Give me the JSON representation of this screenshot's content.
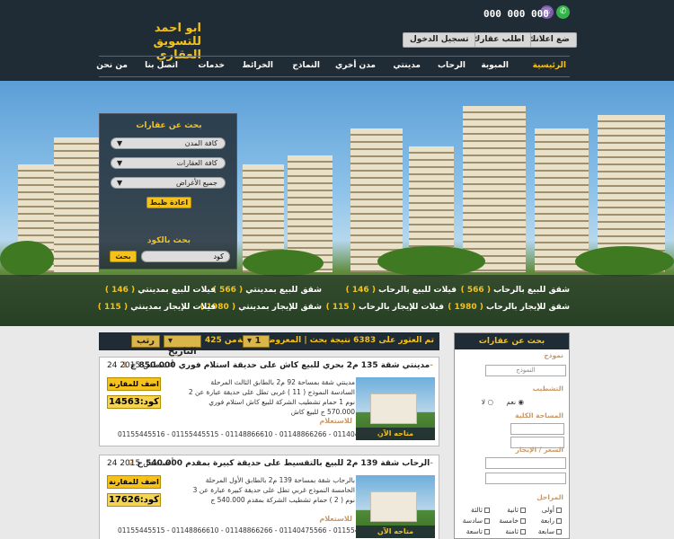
{
  "header": {
    "phone": "000 000 000",
    "brand_line1": "ابو احمد",
    "brand_line2": "للتسويق العقاري",
    "buttons": [
      "ضع اعلانك",
      "اطلب عقارك",
      "تسجيل الدخول"
    ]
  },
  "nav": [
    "الرئيسية",
    "المبوبة",
    "الرحاب",
    "مدينتي",
    "مدن أخري",
    "النماذج",
    "الخرائط",
    "خدمات",
    "اتصل بنا",
    "من نحن"
  ],
  "hero_search": {
    "title": "بحث عن عقارات",
    "select_city": "كافة المدن",
    "select_type": "كافة العقارات",
    "select_purpose": "جميع الأغراض",
    "reset_label": "اعادة ظبط",
    "code_title": "بحث بالكود",
    "code_placeholder": "كود",
    "search_label": "بحث"
  },
  "categories": [
    {
      "label": "شقق للبيع بالرحاب",
      "count": "( 566 )"
    },
    {
      "label": "فيلات للبيع بالرحاب",
      "count": "( 146 )"
    },
    {
      "label": "شقق للبيع بمدينتي",
      "count": "( 566 )"
    },
    {
      "label": "فيلات للبيع بمدينتي",
      "count": "( 146 )"
    },
    {
      "label": "شقق للإيجار بالرحاب",
      "count": "( 1980 )"
    },
    {
      "label": "فيلات للإيجار بالرحاب",
      "count": "( 115 )"
    },
    {
      "label": "شقق للإيجار بمدينتي",
      "count": "( 1980 )"
    },
    {
      "label": "فيلات للإيجار بمدينتي",
      "count": "( 115 )"
    }
  ],
  "results": {
    "summary": "تم العثور على 6383 نتيجة بحث | المعروض صفحة",
    "page": "1",
    "of_pages": "من 425",
    "sort_field": "التاريخ",
    "sort_label": "رتب"
  },
  "listings": [
    {
      "index": "1-",
      "title": "مدينتي شقة 135 م2 بحري للبيع كاش على حديقة استلام فوري 850.000 ج",
      "date": "24 أغسطس 2015",
      "desc": "مدينتي شقة بمساحة 92 م2 بالطابق الثالث المرحلة السادسة النموذج ( 11 ) غربى تطل على حديقة عبارة عن 2 نوم 1 حمام تشطيب الشركة للبيع كاش استلام فوري 570.000 ج للبيع كاش",
      "photo_caption": "متاحه الآن",
      "compare_label": "اضف للمقارنة",
      "code": "كود:14563",
      "contact_label": "للاستعلام",
      "phones": "01155445516 - 01155445515 - 01148866610 - 01148866266 - 01140475566"
    },
    {
      "index": "2-",
      "title": "الرحاب شقة 139 م2 للبيع بالتقسيط على حديقة كبيرة بمقدم 540.000 ج",
      "date": "24 أغسطس 2015",
      "desc": "بالرحاب شقة بمساحة 139 م2 بالطابق الأول المرحلة الخامسة النموذج غربي تطل على حديقة كبيرة عبارة عن 3 نوم ( 2 ) حمام تشطيب الشركة بمقدم 540.000 ج",
      "photo_caption": "متاحه الآن",
      "compare_label": "اضف للمقارنة",
      "code": "كود:17626",
      "contact_label": "للاستعلام",
      "phones": "01155445515 - 01148866610 - 01148866266 - 01140475566 - 01155445516"
    }
  ],
  "sidebar": {
    "title": "بحث عن عقارات",
    "model_label": "نموذج",
    "model_placeholder": "النموذج",
    "finish_label": "التشطيب",
    "finish_yes": "نعم",
    "finish_no": "لا",
    "area_label": "المساحة الكلية",
    "price_label": "السعر / الإيجار",
    "stages_label": "المراحل",
    "stages": [
      "أولى",
      "ثانية",
      "ثالثة",
      "رابعة",
      "خامسة",
      "سادسة",
      "سابعة",
      "ثامنة",
      "تاسعة"
    ]
  }
}
